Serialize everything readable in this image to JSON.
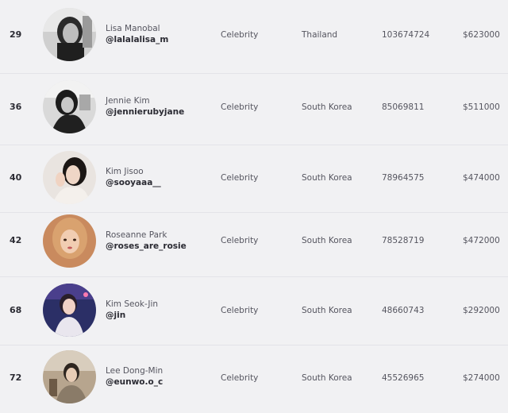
{
  "rows": [
    {
      "rank": "29",
      "name": "Lisa Manobal",
      "handle": "@lalalalisa_m",
      "category": "Celebrity",
      "country": "Thailand",
      "followers": "103674724",
      "price": "$623000",
      "avatar": "portrait-photo-bw"
    },
    {
      "rank": "36",
      "name": "Jennie Kim",
      "handle": "@jennierubyjane",
      "category": "Celebrity",
      "country": "South Korea",
      "followers": "85069811",
      "price": "$511000",
      "avatar": "portrait-photo-bw"
    },
    {
      "rank": "40",
      "name": "Kim Jisoo",
      "handle": "@sooyaaa__",
      "category": "Celebrity",
      "country": "South Korea",
      "followers": "78964575",
      "price": "$474000",
      "avatar": "portrait-photo"
    },
    {
      "rank": "42",
      "name": "Roseanne Park",
      "handle": "@roses_are_rosie",
      "category": "Celebrity",
      "country": "South Korea",
      "followers": "78528719",
      "price": "$472000",
      "avatar": "portrait-photo"
    },
    {
      "rank": "68",
      "name": "Kim Seok-Jin",
      "handle": "@jin",
      "category": "Celebrity",
      "country": "South Korea",
      "followers": "48660743",
      "price": "$292000",
      "avatar": "portrait-photo"
    },
    {
      "rank": "72",
      "name": "Lee Dong-Min",
      "handle": "@eunwo.o_c",
      "category": "Celebrity",
      "country": "South Korea",
      "followers": "45526965",
      "price": "$274000",
      "avatar": "portrait-photo"
    }
  ],
  "colors": {
    "background": "#f1f1f3",
    "row_divider": "#e3e3e8",
    "text_primary": "#2b2b33",
    "text_secondary": "#55555f"
  }
}
